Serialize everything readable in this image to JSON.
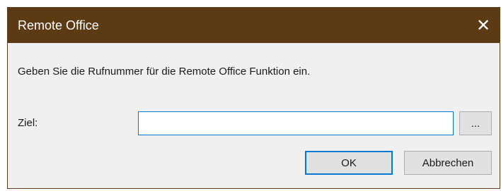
{
  "window": {
    "title": "Remote Office",
    "close_glyph": "✕"
  },
  "content": {
    "instruction": "Geben Sie die Rufnummer für die Remote Office Funktion ein.",
    "ziel_label": "Ziel:",
    "ziel_value": "",
    "browse_label": "..."
  },
  "buttons": {
    "ok_label": "OK",
    "cancel_label": "Abbrechen"
  },
  "colors": {
    "titlebar": "#5c3b14",
    "focus_accent": "#0078d7"
  }
}
